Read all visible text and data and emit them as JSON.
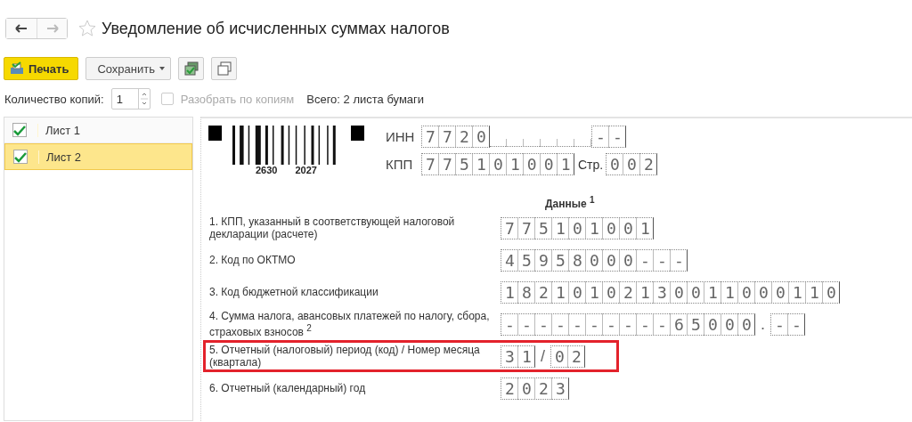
{
  "title": "Уведомление об исчисленных суммах налогов",
  "favorite": false,
  "toolbar": {
    "print": "Печать",
    "save": "Сохранить"
  },
  "copies": {
    "label": "Количество копий:",
    "value": "1",
    "collate": {
      "label": "Разобрать по копиям",
      "checked": false,
      "disabled": true
    },
    "total": "Всего: 2 листа бумаги"
  },
  "sheets": [
    {
      "label": "Лист 1",
      "checked": true,
      "selected": false
    },
    {
      "label": "Лист 2",
      "checked": true,
      "selected": true
    }
  ],
  "document": {
    "barcode": [
      "2630",
      "2027"
    ],
    "inn": {
      "label": "ИНН",
      "parts": [
        {
          "kind": "cells",
          "text": "7720"
        },
        {
          "kind": "hidden"
        },
        {
          "kind": "cells",
          "text": "--"
        }
      ]
    },
    "kpp": {
      "label": "КПП",
      "parts": [
        {
          "kind": "cells",
          "text": "775101001"
        }
      ]
    },
    "page": {
      "label": "Стр.",
      "parts": [
        {
          "kind": "cells",
          "text": "002"
        }
      ]
    },
    "section": "Данные $^{1}$",
    "rows": [
      {
        "label": "1. КПП, указанный в соответствующей налоговой декларации (расчете)",
        "highlighted": false,
        "parts": [
          {
            "kind": "cells",
            "text": "775101001"
          }
        ]
      },
      {
        "label": "2. Код по ОКТМО",
        "highlighted": false,
        "parts": [
          {
            "kind": "cells",
            "text": "45958000---"
          }
        ]
      },
      {
        "label": "3. Код бюджетной классификации",
        "highlighted": false,
        "parts": [
          {
            "kind": "cells",
            "text": "18210102130011000110"
          }
        ]
      },
      {
        "label": "4. Сумма налога, авансовых платежей по налогу, сбора, страховых взносов $^{2}$",
        "highlighted": false,
        "parts": [
          {
            "kind": "cells",
            "text": "----------65000"
          },
          {
            "kind": "sep",
            "text": "."
          },
          {
            "kind": "cells",
            "text": "--"
          }
        ]
      },
      {
        "label": "5. Отчетный (налоговый) период (код) / Номер месяца (квартала)",
        "highlighted": true,
        "parts": [
          {
            "kind": "cells",
            "text": "31"
          },
          {
            "kind": "sep",
            "text": "/"
          },
          {
            "kind": "cells",
            "text": "02"
          }
        ]
      },
      {
        "label": "6. Отчетный (календарный) год",
        "highlighted": false,
        "parts": [
          {
            "kind": "cells",
            "text": "2023"
          }
        ]
      }
    ]
  }
}
